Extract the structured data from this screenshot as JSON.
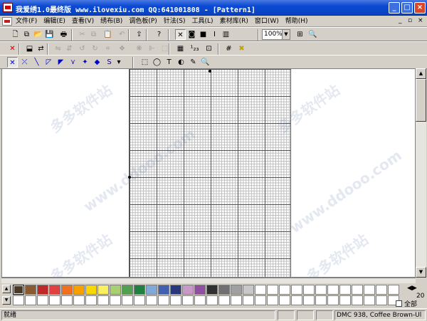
{
  "window": {
    "title": "我爱绣1.0最终版 www.ilovexiu.com QQ:641001808 - [Pattern1]",
    "caption_buttons": [
      "minimize-icon",
      "maximize-icon",
      "close-icon"
    ],
    "caption_glyphs": {
      "minimize": "_",
      "maximize": "□",
      "close": "×"
    },
    "titlebar_color": "#0a4ad4"
  },
  "menu": {
    "items": [
      "文件(F)",
      "编辑(E)",
      "查看(V)",
      "绣布(B)",
      "调色板(P)",
      "针法(S)",
      "工具(L)",
      "素材库(R)",
      "窗口(W)",
      "帮助(H)"
    ],
    "mdi_controls": {
      "minimize": "_",
      "restore": "▫",
      "close": "×"
    }
  },
  "toolbar1": {
    "buttons": [
      {
        "name": "new-icon",
        "glyph": "🗋"
      },
      {
        "name": "copy-icon",
        "glyph": "⧉"
      },
      {
        "name": "open-icon",
        "glyph": "📂"
      },
      {
        "name": "save-icon",
        "glyph": "💾"
      },
      {
        "name": "print-icon",
        "glyph": "🖶"
      },
      {
        "name": "cut-icon",
        "glyph": "✂",
        "disabled": true
      },
      {
        "name": "copy-disabled-icon",
        "glyph": "⧉",
        "disabled": true
      },
      {
        "name": "paste-icon",
        "glyph": "📋",
        "disabled": true
      },
      {
        "name": "undo-icon",
        "glyph": "↶",
        "disabled": true
      },
      {
        "name": "import-icon",
        "glyph": "⇪"
      },
      {
        "name": "help-icon",
        "glyph": "?"
      },
      {
        "name": "cross-stitch-view-icon",
        "glyph": "✕",
        "pressed": true
      },
      {
        "name": "symbol-view-icon",
        "glyph": "◙"
      },
      {
        "name": "color-view-icon",
        "glyph": "■"
      },
      {
        "name": "text-view-icon",
        "glyph": "I"
      },
      {
        "name": "realistic-view-icon",
        "glyph": "▥"
      },
      {
        "name": "zoom-fit-icon",
        "glyph": "⊞"
      },
      {
        "name": "zoom-tool-icon",
        "glyph": "🔍"
      }
    ],
    "zoom_value": "100%"
  },
  "toolbar2": {
    "buttons": [
      {
        "name": "delete-icon",
        "glyph": "✕",
        "color": "#c00000"
      },
      {
        "name": "color-replace-icon",
        "glyph": "⬓"
      },
      {
        "name": "swap-colors-icon",
        "glyph": "⇄"
      },
      {
        "name": "flip-horizontal-icon",
        "glyph": "⇋",
        "disabled": true
      },
      {
        "name": "flip-vertical-icon",
        "glyph": "⇵",
        "disabled": true
      },
      {
        "name": "rotate-left-icon",
        "glyph": "↺",
        "disabled": true
      },
      {
        "name": "rotate-right-icon",
        "glyph": "↻",
        "disabled": true
      },
      {
        "name": "crop-icon",
        "glyph": "⌗",
        "disabled": true
      },
      {
        "name": "transform-icon",
        "glyph": "❖",
        "disabled": true
      },
      {
        "name": "mirror-icon",
        "glyph": "❋",
        "disabled": true
      },
      {
        "name": "align-icon",
        "glyph": "⊩",
        "disabled": true
      },
      {
        "name": "frame-icon",
        "glyph": "⬚",
        "disabled": true
      },
      {
        "name": "palette-icon",
        "glyph": "▦"
      },
      {
        "name": "numbering-icon",
        "glyph": "¹₂₃"
      },
      {
        "name": "grid-settings-icon",
        "glyph": "⊡"
      },
      {
        "name": "grid-lines-icon",
        "glyph": "#"
      },
      {
        "name": "cross-mark-icon",
        "glyph": "✖",
        "color": "#c8a000"
      }
    ]
  },
  "toolbar3": {
    "buttons": [
      {
        "name": "full-stitch-icon",
        "glyph": "✕",
        "color": "#0000c0",
        "pressed": true
      },
      {
        "name": "half-cross-icon",
        "glyph": "⤫",
        "color": "#0000c0"
      },
      {
        "name": "half-stitch-icon",
        "glyph": "╲",
        "color": "#0000c0"
      },
      {
        "name": "quarter-stitch-icon",
        "glyph": "◸",
        "color": "#0000c0"
      },
      {
        "name": "three-quarter-stitch-icon",
        "glyph": "◤",
        "color": "#0000c0"
      },
      {
        "name": "backstitch-icon",
        "glyph": "⋎",
        "color": "#0000c0"
      },
      {
        "name": "french-knot-icon",
        "glyph": "✦",
        "color": "#0000c0"
      },
      {
        "name": "bead-icon",
        "glyph": "◆",
        "color": "#0000c0"
      },
      {
        "name": "special-stitch-icon",
        "glyph": "S",
        "color": "#0000c0"
      },
      {
        "name": "select-rect-icon",
        "glyph": "⬚"
      },
      {
        "name": "select-lasso-icon",
        "glyph": "◯"
      },
      {
        "name": "text-tool-icon",
        "glyph": "T"
      },
      {
        "name": "fill-tool-icon",
        "glyph": "◐"
      },
      {
        "name": "eyedropper-icon",
        "glyph": "✎"
      },
      {
        "name": "magnifier-icon",
        "glyph": "🔍"
      }
    ],
    "dropdown_glyph": "▾"
  },
  "palette": {
    "colors": [
      "#4a3a28",
      "#8a5a30",
      "#c02828",
      "#e04040",
      "#f07020",
      "#f8a000",
      "#f8d800",
      "#f8f060",
      "#a8d070",
      "#50a050",
      "#208040",
      "#80a8d8",
      "#4060b0",
      "#283878",
      "#c898c8",
      "#9050a0",
      "#303030",
      "#707070",
      "#a0a0a0",
      "#c8c8c8",
      "#ffffff"
    ],
    "empty_slot_color": "#ffffff",
    "nav_left": "◀",
    "nav_right": "▶",
    "scroll_up": "▲",
    "scroll_down": "▼",
    "page_number": "20",
    "all_label": "全部"
  },
  "status": {
    "ready": "就绪",
    "thread": "DMC  938, Coffee Brown-Ul"
  },
  "scrollbar": {
    "up": "▲",
    "down": "▼"
  },
  "watermark": [
    "多多软件站",
    "www.ddooo.com"
  ]
}
